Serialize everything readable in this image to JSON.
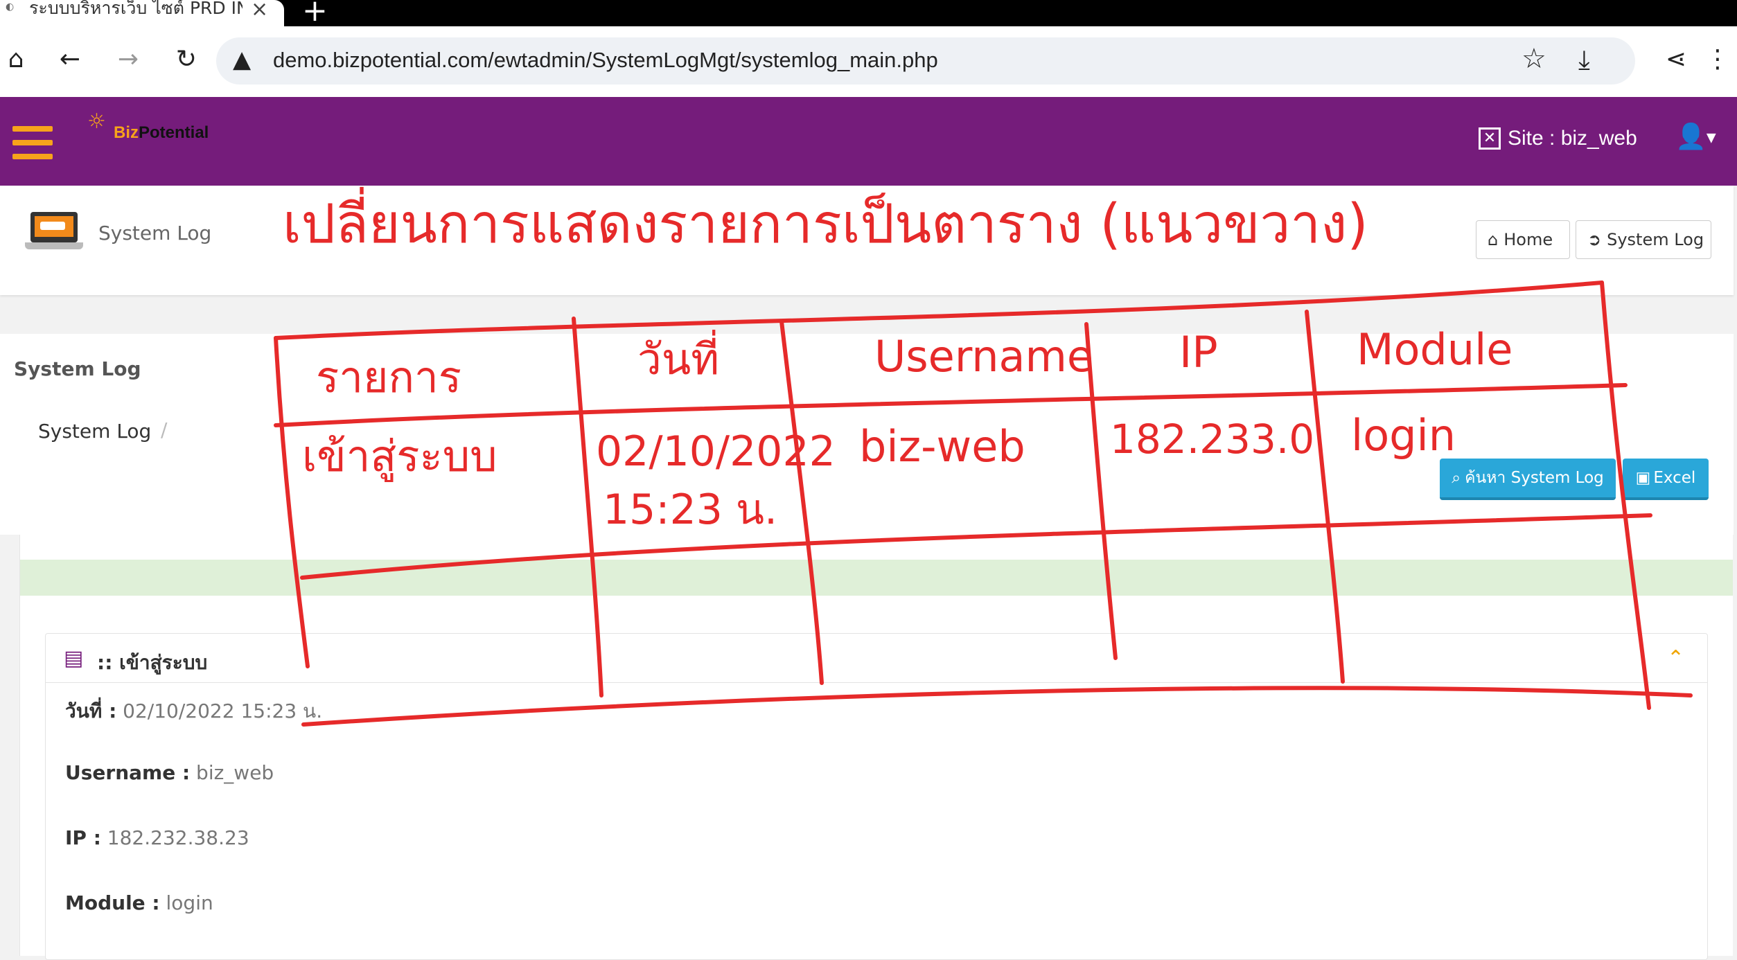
{
  "browser": {
    "tab_title": "ระบบบริหารเว็บ ไซต์ PRD IN",
    "url": "demo.bizpotential.com/ewtadmin/SystemLogMgt/systemlog_main.php"
  },
  "header": {
    "logo_biz": "Biz",
    "logo_potential": "Potential",
    "site_label": "Site : biz_web"
  },
  "page": {
    "title": "System Log",
    "home_button": "Home",
    "systemlog_button": "System Log"
  },
  "section": {
    "title": "System Log",
    "breadcrumb": "System Log",
    "breadcrumb_sep": "/",
    "search_button": "ค้นหา System Log",
    "excel_button": "Excel"
  },
  "panel": {
    "title": ":: เข้าสู่ระบบ",
    "fields": [
      {
        "label": "วันที่ :",
        "value": "02/10/2022 15:23 น."
      },
      {
        "label": "Username :",
        "value": "biz_web"
      },
      {
        "label": "IP :",
        "value": "182.232.38.23"
      },
      {
        "label": "Module :",
        "value": "login"
      }
    ]
  },
  "annotation": {
    "note": "เปลี่ยนการแสดงรายการเป็นตาราง (แนวขวาง)",
    "table_headers": [
      "รายการ",
      "วันที่",
      "Username",
      "IP",
      "Module"
    ],
    "table_row": [
      "เข้าสู่ระบบ",
      "02/10/2022",
      "biz-web",
      "182.233.0",
      "login"
    ],
    "time_line": "15:23 น.",
    "color": "#e62a2a"
  },
  "colors": {
    "brand_purple": "#751c7b",
    "brand_orange": "#f7a31b",
    "button_blue": "#2aa7d9",
    "success_bg": "#dff0d8"
  }
}
